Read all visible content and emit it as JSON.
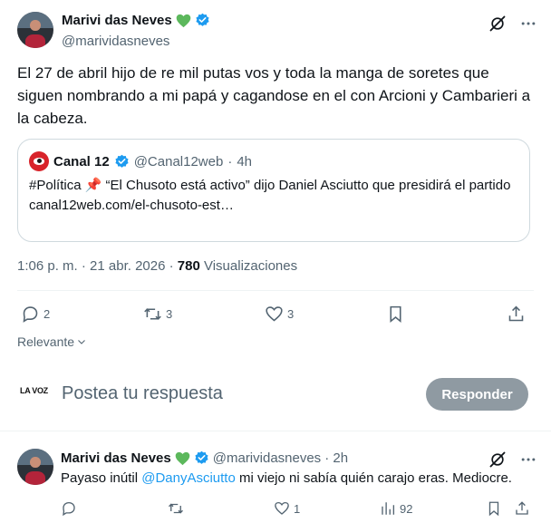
{
  "post": {
    "author_name": "Marivi das Neves",
    "author_handle": "@marividasneves",
    "text": "El 27 de abril hijo de re mil putas vos y toda la manga de soretes que siguen nombrando a mi papá y cagandose en el con Arcioni y Cambarieri a la cabeza.",
    "quote": {
      "name": "Canal 12",
      "handle": "@Canal12web",
      "time": "4h",
      "text": "#Política 📌 “El Chusoto está activo” dijo Daniel Asciutto que presidirá el partido",
      "link": "canal12web.com/el-chusoto-est…"
    },
    "meta": {
      "time": "1:06 p. m. · 21 abr. 2026 · ",
      "views_count": "780",
      "views_label": " Visualizaciones"
    },
    "actions": {
      "replies": "2",
      "reposts": "3",
      "likes": "3"
    },
    "sort_label": "Relevante"
  },
  "reply_box": {
    "avatar_text": "LA VOZ",
    "placeholder": "Postea tu respuesta",
    "button_label": "Responder"
  },
  "reply": {
    "author_name": "Marivi das Neves",
    "author_handle": "@marividasneves",
    "time": "· 2h",
    "text_before": "Payaso inútil ",
    "mention": "@DanyAsciutto",
    "text_after": " mi viejo ni sabía quién carajo eras. Mediocre.",
    "actions": {
      "replies": "",
      "reposts": "",
      "likes": "1",
      "views": "92"
    }
  },
  "colors": {
    "accent": "#1d9bf0",
    "verified": "#1d9bf0",
    "heart": "#5cb85c",
    "button_disabled": "#8f9aa2"
  }
}
